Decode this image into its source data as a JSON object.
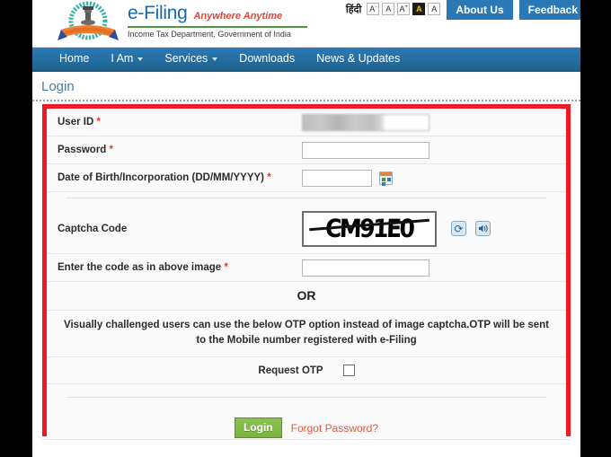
{
  "header": {
    "emblem_icon": "india-national-emblem-icon",
    "brand_title": "e-Filing",
    "brand_tagline": "Anywhere Anytime",
    "brand_department": "Income Tax Department, Government of India",
    "hindi_link": "हिंदी",
    "font_buttons": [
      {
        "label": "A",
        "sup": "-",
        "name": "decrease-font-size-button",
        "state": "normal"
      },
      {
        "label": "A",
        "sup": "",
        "name": "default-font-size-button",
        "state": "normal"
      },
      {
        "label": "A",
        "sup": "+",
        "name": "increase-font-size-button",
        "state": "normal"
      },
      {
        "label": "A",
        "sup": "",
        "name": "high-contrast-button",
        "state": "active"
      },
      {
        "label": "A",
        "sup": "",
        "name": "normal-contrast-button",
        "state": "normal"
      }
    ],
    "about_us_label": "About Us",
    "feedback_label": "Feedback"
  },
  "nav": {
    "items": [
      {
        "label": "Home",
        "has_caret": false,
        "name": "nav-item-home"
      },
      {
        "label": "I Am",
        "has_caret": true,
        "name": "nav-item-i-am"
      },
      {
        "label": "Services",
        "has_caret": true,
        "name": "nav-item-services"
      },
      {
        "label": "Downloads",
        "has_caret": false,
        "name": "nav-item-downloads"
      },
      {
        "label": "News & Updates",
        "has_caret": false,
        "name": "nav-item-news-updates"
      }
    ]
  },
  "page": {
    "title": "Login"
  },
  "form": {
    "user_id": {
      "label": "User ID",
      "required_marker": "*",
      "value": "",
      "placeholder": ""
    },
    "password": {
      "label": "Password",
      "required_marker": "*",
      "value": "",
      "placeholder": ""
    },
    "dob": {
      "label": "Date of Birth/Incorporation (DD/MM/YYYY)",
      "required_marker": "*",
      "value": "",
      "placeholder": "",
      "calendar_icon": "calendar-icon"
    },
    "captcha": {
      "label": "Captcha Code",
      "required_marker": "",
      "image_text": "CM91E0",
      "refresh_icon": "refresh-icon",
      "refresh_glyph": "⟳",
      "audio_icon": "speaker-icon",
      "audio_glyph": "◀))"
    },
    "captcha_entry": {
      "label": "Enter the code as in above image",
      "required_marker": "*",
      "value": "",
      "placeholder": ""
    },
    "or_separator": "OR",
    "otp_note": "Visually challenged users can use the below OTP option instead of image captcha.OTP will be sent to the Mobile number registered with e-Filing",
    "request_otp": {
      "label": "Request OTP",
      "checked": false
    },
    "login_button": "Login",
    "forgot_password": "Forgot Password?"
  },
  "colors": {
    "nav_blue": "#2b7ab8",
    "brand_blue": "#1a6aa8",
    "tagline_red": "#e0453a",
    "frame_red": "#ee1b24",
    "login_green": "#7ab33f",
    "link_orange": "#e2583e",
    "title_blue": "#4a7fa8"
  }
}
